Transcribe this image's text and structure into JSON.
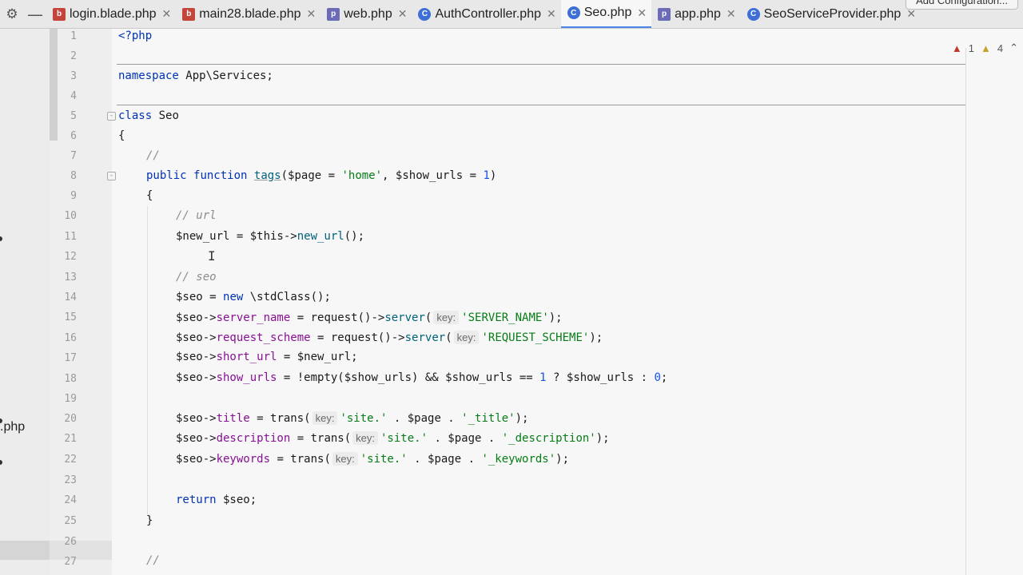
{
  "toolbar": {
    "settings_icon": "gear-icon",
    "minimize_icon": "minus-icon",
    "add_configuration": "Add Configuration..."
  },
  "tabs": [
    {
      "name": "login.blade.php",
      "icon": "blade-file-icon",
      "active": false
    },
    {
      "name": "main28.blade.php",
      "icon": "blade-file-icon",
      "active": false
    },
    {
      "name": "web.php",
      "icon": "php-file-icon",
      "active": false
    },
    {
      "name": "AuthController.php",
      "icon": "class-file-icon",
      "active": false
    },
    {
      "name": "Seo.php",
      "icon": "class-file-icon",
      "active": true
    },
    {
      "name": "app.php",
      "icon": "php-file-icon",
      "active": false
    },
    {
      "name": "SeoServiceProvider.php",
      "icon": "class-file-icon",
      "active": false
    }
  ],
  "inspections": {
    "errors": "1",
    "warnings": "4"
  },
  "project_panel": {
    "partial_label": ".php"
  },
  "line_numbers": [
    "1",
    "2",
    "3",
    "4",
    "5",
    "6",
    "7",
    "8",
    "9",
    "10",
    "11",
    "12",
    "13",
    "14",
    "15",
    "16",
    "17",
    "18",
    "19",
    "20",
    "21",
    "22",
    "23",
    "24",
    "25",
    "26",
    "27"
  ],
  "code": {
    "l1_php_open": "<?php",
    "l3_namespace_kw": "namespace",
    "l3_namespace": " App\\Services;",
    "l5_class_kw": "class",
    "l5_class_name": " Seo",
    "l6": "{",
    "l7": "//",
    "l8_public": "public",
    "l8_function": "function",
    "l8_name": "tags",
    "l8_p1": "($page = ",
    "l8_s1": "'home'",
    "l8_p2": ", $show_urls = ",
    "l8_n1": "1",
    "l8_p3": ")",
    "l9": "{",
    "l10": "// url",
    "l11_a": "$new_url = $this->",
    "l11_b": "new_url",
    "l11_c": "();",
    "l13": "// seo",
    "l14_a": "$seo = ",
    "l14_new": "new",
    "l14_b": " \\stdClass();",
    "l15_a": "$seo->",
    "l15_prop": "server_name",
    "l15_b": " = request()->",
    "l15_fn": "server",
    "l15_c": "(",
    "l15_hint": "key:",
    "l15_str": "'SERVER_NAME'",
    "l15_d": ");",
    "l16_a": "$seo->",
    "l16_prop": "request_scheme",
    "l16_b": " = request()->",
    "l16_fn": "server",
    "l16_c": "(",
    "l16_hint": "key:",
    "l16_str": "'REQUEST_SCHEME'",
    "l16_d": ");",
    "l17_a": "$seo->",
    "l17_prop": "short_url",
    "l17_b": " = $new_url;",
    "l18_a": "$seo->",
    "l18_prop": "show_urls",
    "l18_b": " = !empty($show_urls) && $show_urls == ",
    "l18_n1": "1",
    "l18_c": " ? $show_urls : ",
    "l18_n2": "0",
    "l18_d": ";",
    "l20_a": "$seo->",
    "l20_prop": "title",
    "l20_b": " = trans(",
    "l20_hint": "key:",
    "l20_s1": "'site.'",
    "l20_c": " . $page . ",
    "l20_s2": "'_title'",
    "l20_d": ");",
    "l21_a": "$seo->",
    "l21_prop": "description",
    "l21_b": " = trans(",
    "l21_hint": "key:",
    "l21_s1": "'site.'",
    "l21_c": " . $page . ",
    "l21_s2": "'_description'",
    "l21_d": ");",
    "l22_a": "$seo->",
    "l22_prop": "keywords",
    "l22_b": " = trans(",
    "l22_hint": "key:",
    "l22_s1": "'site.'",
    "l22_c": " . $page . ",
    "l22_s2": "'_keywords'",
    "l22_d": ");",
    "l24_return": "return",
    "l24_b": " $seo;",
    "l25": "}",
    "l27": "//"
  }
}
